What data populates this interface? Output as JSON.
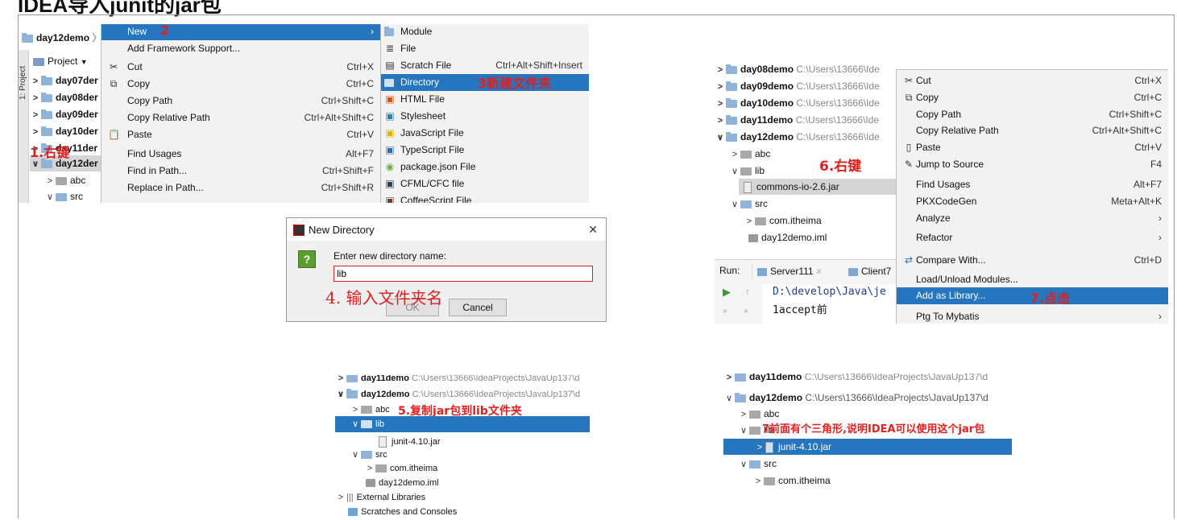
{
  "title": "IDEA导入junit的jar包",
  "colors": {
    "selection": "#2675bf",
    "annotation": "#e02020",
    "menu_bg": "#f2f2f2"
  },
  "panel1": {
    "breadcrumb": "day12demo",
    "project_label": "Project",
    "side_tab": "1: Project",
    "tree": [
      "day07der",
      "day08der",
      "day09der",
      "day10der",
      "day11der",
      "day12der",
      "abc",
      "src"
    ],
    "annotation": "1.右键",
    "context_menu": [
      {
        "label": "New",
        "shortcut": "",
        "selected": true
      },
      {
        "label": "Add Framework Support...",
        "shortcut": ""
      },
      {
        "label": "Cut",
        "shortcut": "Ctrl+X"
      },
      {
        "label": "Copy",
        "shortcut": "Ctrl+C"
      },
      {
        "label": "Copy Path",
        "shortcut": "Ctrl+Shift+C"
      },
      {
        "label": "Copy Relative Path",
        "shortcut": "Ctrl+Alt+Shift+C"
      },
      {
        "label": "Paste",
        "shortcut": "Ctrl+V"
      },
      {
        "label": "Find Usages",
        "shortcut": "Alt+F7"
      },
      {
        "label": "Find in Path...",
        "shortcut": "Ctrl+Shift+F"
      },
      {
        "label": "Replace in Path...",
        "shortcut": "Ctrl+Shift+R"
      }
    ],
    "new_annotation": "2",
    "submenu": [
      {
        "label": "Module",
        "shortcut": ""
      },
      {
        "label": "File",
        "shortcut": ""
      },
      {
        "label": "Scratch File",
        "shortcut": "Ctrl+Alt+Shift+Insert"
      },
      {
        "label": "Directory",
        "shortcut": "",
        "selected": true
      },
      {
        "label": "HTML File",
        "shortcut": ""
      },
      {
        "label": "Stylesheet",
        "shortcut": ""
      },
      {
        "label": "JavaScript File",
        "shortcut": ""
      },
      {
        "label": "TypeScript File",
        "shortcut": ""
      },
      {
        "label": "package.json File",
        "shortcut": ""
      },
      {
        "label": "CFML/CFC file",
        "shortcut": ""
      },
      {
        "label": "CoffeeScript File",
        "shortcut": ""
      }
    ],
    "dir_annotation": "3新建文件夹"
  },
  "dialog": {
    "title": "New Directory",
    "close": "✕",
    "prompt": "Enter new directory name:",
    "value": "lib",
    "ok": "OK",
    "cancel": "Cancel",
    "annotation": "4. 输入文件夹名"
  },
  "panel3": {
    "tree": [
      {
        "name": "day08demo",
        "path": "C:\\Users\\13666\\Ide"
      },
      {
        "name": "day09demo",
        "path": "C:\\Users\\13666\\Ide"
      },
      {
        "name": "day10demo",
        "path": "C:\\Users\\13666\\Ide"
      },
      {
        "name": "day11demo",
        "path": "C:\\Users\\13666\\Ide"
      },
      {
        "name": "day12demo",
        "path": "C:\\Users\\13666\\Ide"
      }
    ],
    "abc": "abc",
    "lib": "lib",
    "jar": "commons-io-2.6.jar",
    "src": "src",
    "pkg": "com.itheima",
    "iml": "day12demo.iml",
    "annotation": "6.右键",
    "run_label": "Run:",
    "run_tabs": [
      "Server111",
      "Client7"
    ],
    "console": [
      "D:\\develop\\Java\\je",
      "1accept前"
    ],
    "context_menu": [
      {
        "label": "Cut",
        "shortcut": "Ctrl+X"
      },
      {
        "label": "Copy",
        "shortcut": "Ctrl+C"
      },
      {
        "label": "Copy Path",
        "shortcut": "Ctrl+Shift+C"
      },
      {
        "label": "Copy Relative Path",
        "shortcut": "Ctrl+Alt+Shift+C"
      },
      {
        "label": "Paste",
        "shortcut": "Ctrl+V"
      },
      {
        "label": "Jump to Source",
        "shortcut": "F4"
      },
      {
        "label": "Find Usages",
        "shortcut": "Alt+F7"
      },
      {
        "label": "PKXCodeGen",
        "shortcut": "Meta+Alt+K"
      },
      {
        "label": "Analyze",
        "shortcut": ""
      },
      {
        "label": "Refactor",
        "shortcut": ""
      },
      {
        "label": "Compare With...",
        "shortcut": "Ctrl+D"
      },
      {
        "label": "Load/Unload Modules...",
        "shortcut": ""
      },
      {
        "label": "Add as Library...",
        "shortcut": "",
        "selected": true
      },
      {
        "label": "Ptg To Mybatis",
        "shortcut": ""
      }
    ],
    "lib_annotation": "7.点击"
  },
  "panel4": {
    "day11": "day11demo",
    "day11_path": "C:\\Users\\13666\\IdeaProjects\\JavaUp137\\d",
    "day12": "day12demo",
    "day12_path": "C:\\Users\\13666\\IdeaProjects\\JavaUp137\\d",
    "abc": "abc",
    "annotation": "5.复制jar包到lib文件夹",
    "lib": "lib",
    "jar": "junit-4.10.jar",
    "src": "src",
    "pkg": "com.itheima",
    "iml": "day12demo.iml",
    "ext": "External Libraries",
    "scratch": "Scratches and Consoles"
  },
  "panel5": {
    "day11": "day11demo",
    "day11_path": "C:\\Users\\13666\\IdeaProjects\\JavaUp137\\d",
    "day12": "day12demo",
    "day12_path": "C:\\Users\\13666\\IdeaProjects\\JavaUp137\\d",
    "abc": "abc",
    "lib": "lib",
    "annotation": "7前面有个三角形,说明IDEA可以使用这个jar包",
    "jar": "junit-4.10.jar",
    "src": "src",
    "pkg": "com.itheima"
  }
}
